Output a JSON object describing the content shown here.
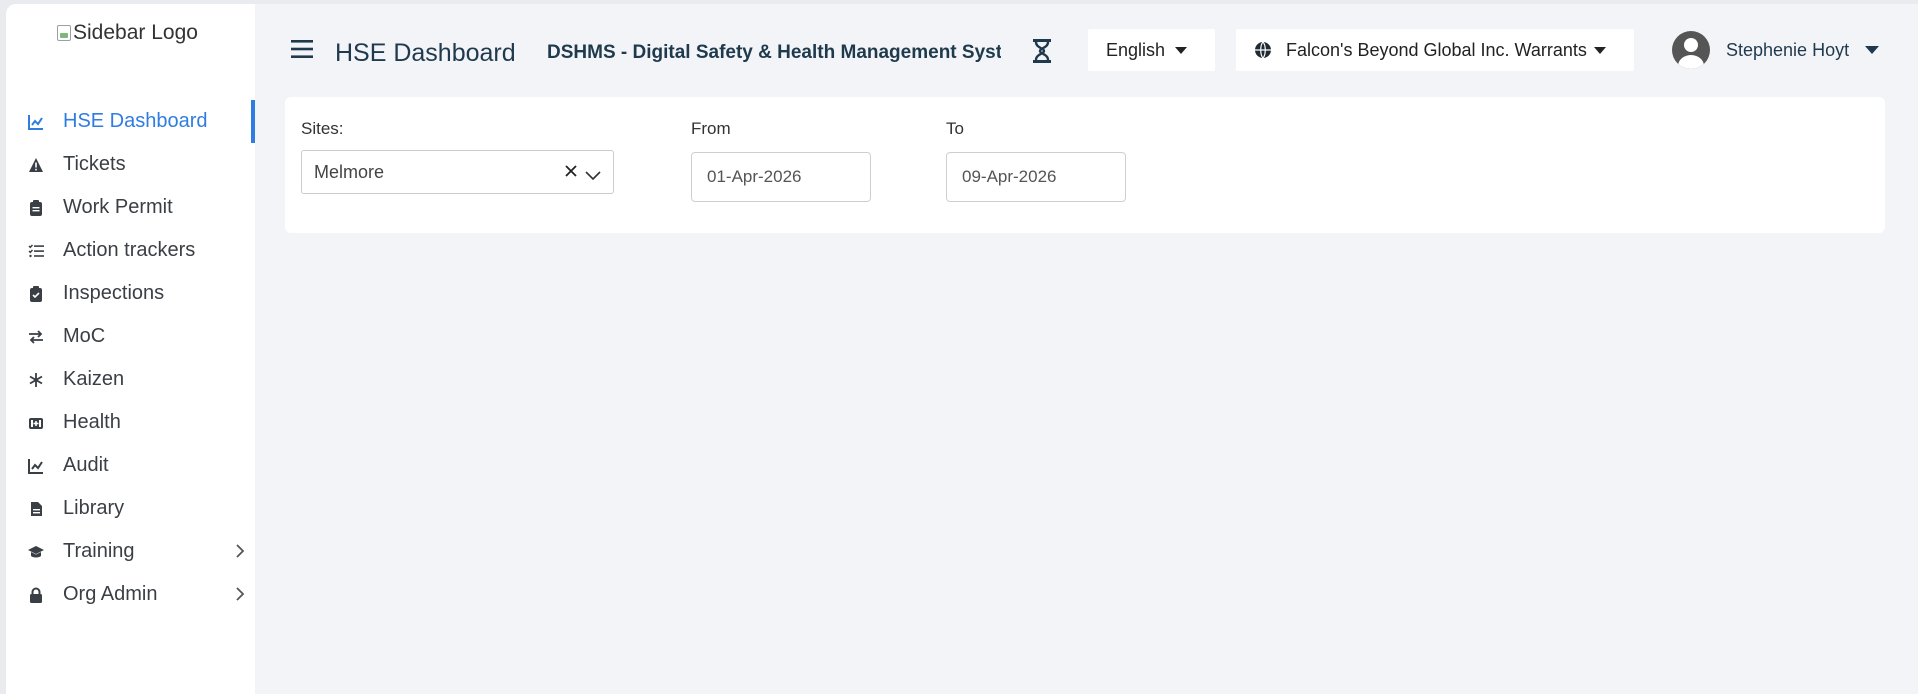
{
  "sidebar": {
    "logo_alt": "Sidebar Logo",
    "items": [
      {
        "label": "HSE Dashboard",
        "icon": "chart-line-icon",
        "active": true
      },
      {
        "label": "Tickets",
        "icon": "warning-triangle-icon"
      },
      {
        "label": "Work Permit",
        "icon": "clipboard-icon"
      },
      {
        "label": "Action trackers",
        "icon": "list-check-icon"
      },
      {
        "label": "Inspections",
        "icon": "clipboard-check-icon"
      },
      {
        "label": "MoC",
        "icon": "arrows-exchange-icon"
      },
      {
        "label": "Kaizen",
        "icon": "snowflake-icon"
      },
      {
        "label": "Health",
        "icon": "medkit-icon"
      },
      {
        "label": "Audit",
        "icon": "chart-line-icon"
      },
      {
        "label": "Library",
        "icon": "file-icon"
      },
      {
        "label": "Training",
        "icon": "graduation-cap-icon",
        "expandable": true
      },
      {
        "label": "Org Admin",
        "icon": "lock-icon",
        "expandable": true
      }
    ]
  },
  "header": {
    "page_title": "HSE Dashboard",
    "system_title": "DSHMS - Digital Safety & Health Management System",
    "language": "English",
    "organization": "Falcon's Beyond Global Inc. Warrants",
    "user_name": "Stephenie Hoyt"
  },
  "filters": {
    "sites_label": "Sites:",
    "sites_value": "Melmore",
    "from_label": "From",
    "from_value": "01-Apr-2026",
    "to_label": "To",
    "to_value": "09-Apr-2026"
  },
  "colors": {
    "accent": "#2f7de1",
    "background": "#f3f4f8",
    "header_text": "#1f3a4d"
  }
}
